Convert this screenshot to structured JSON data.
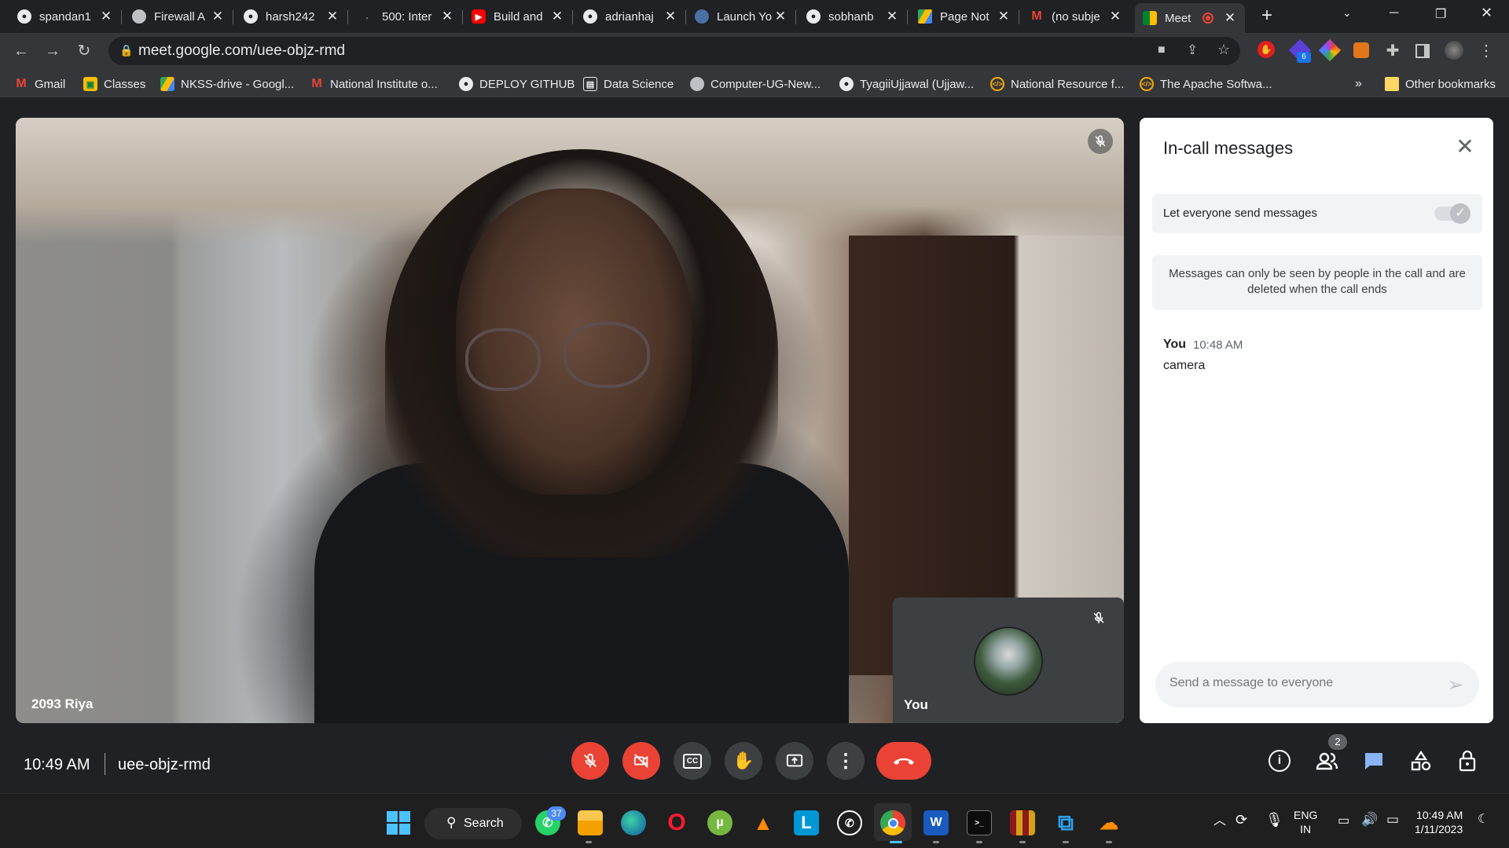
{
  "tabs": [
    {
      "title": "spandan1",
      "icon": "github-icon"
    },
    {
      "title": "Firewall A",
      "icon": "globe-icon"
    },
    {
      "title": "harsh242",
      "icon": "github-icon"
    },
    {
      "title": "500: Inter",
      "icon": "page-icon"
    },
    {
      "title": "Build and",
      "icon": "youtube-icon"
    },
    {
      "title": "adrianhaj",
      "icon": "github-icon"
    },
    {
      "title": "Launch Yo",
      "icon": "page-icon"
    },
    {
      "title": "sobhanb",
      "icon": "github-icon"
    },
    {
      "title": "Page Not",
      "icon": "drive-icon"
    },
    {
      "title": "(no subje",
      "icon": "gmail-icon"
    },
    {
      "title": "Meet",
      "icon": "meet-icon",
      "active": true
    }
  ],
  "url": "meet.google.com/uee-objz-rmd",
  "bookmarks": [
    {
      "label": "Gmail",
      "icon": "gmail-icon"
    },
    {
      "label": "Classes",
      "icon": "classroom-icon"
    },
    {
      "label": "NKSS-drive - Googl...",
      "icon": "drive-icon"
    },
    {
      "label": "National Institute o...",
      "icon": "gmail-icon"
    },
    {
      "label": "DEPLOY GITHUB",
      "icon": "github-icon"
    },
    {
      "label": "Data Science",
      "icon": "notebook-icon"
    },
    {
      "label": "Computer-UG-New...",
      "icon": "globe-icon"
    },
    {
      "label": "TyagiiUjjawal (Ujjaw...",
      "icon": "github-icon"
    },
    {
      "label": "National Resource f...",
      "icon": "code-icon"
    },
    {
      "label": "The Apache Softwa...",
      "icon": "code-icon"
    }
  ],
  "bookmarks_more": "»",
  "other_bookmarks": "Other bookmarks",
  "extensions_badge": "6",
  "main_tile_name": "2093 Riya",
  "self_tile_name": "You",
  "panel": {
    "title": "In-call messages",
    "allow_label": "Let everyone send messages",
    "info": "Messages can only be seen by people in the call and are deleted when the call ends",
    "messages": [
      {
        "sender": "You",
        "time": "10:48 AM",
        "text": "camera"
      }
    ],
    "input_placeholder": "Send a message to everyone"
  },
  "bottom": {
    "time": "10:49 AM",
    "meeting_code": "uee-objz-rmd",
    "participants_count": "2"
  },
  "taskbar": {
    "search_label": "Search",
    "whatsapp_badge": "37",
    "lang_line1": "ENG",
    "lang_line2": "IN",
    "time": "10:49 AM",
    "date": "1/11/2023"
  },
  "colors": {
    "meet_bg": "#202124",
    "danger": "#ea4335",
    "chrome_toolbar": "#35363a",
    "chat_icon": "#8ab4f8"
  }
}
